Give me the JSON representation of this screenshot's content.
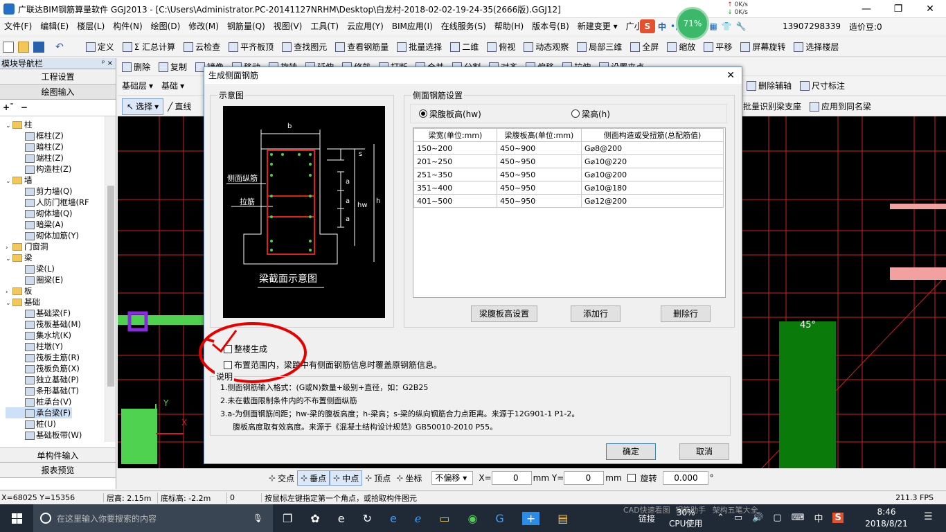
{
  "window": {
    "title": "广联达BIM钢筋算量软件 GGJ2013 - [C:\\Users\\Administrator.PC-20141127NRHM\\Desktop\\白龙村-2018-02-02-19-24-35(2666版).GGJ12]",
    "minimize": "—",
    "restore": "❐",
    "close": "✕"
  },
  "network": {
    "percent": "71%",
    "speed_up": "0K/s",
    "speed_down": "0K/s"
  },
  "menu": [
    "文件(F)",
    "编辑(E)",
    "楼层(L)",
    "构件(N)",
    "绘图(D)",
    "修改(M)",
    "钢筋量(Q)",
    "视图(V)",
    "工具(T)",
    "云应用(Y)",
    "BIM应用(I)",
    "在线服务(S)",
    "帮助(H)",
    "版本号(B)",
    "新建变更 ▾",
    "广小二"
  ],
  "menu_right": {
    "phone": "13907298339",
    "price_beans": "造价豆:0"
  },
  "ime": {
    "lang": "中",
    "punct": "•,"
  },
  "toolbar1": [
    "定义",
    "Σ 汇总计算",
    "云检查",
    "平齐板顶",
    "查找图元",
    "查看钢筋量",
    "批量选择",
    "二维",
    "俯视",
    "动态观察",
    "局部三维",
    "全屏",
    "缩放",
    "平移",
    "屏幕旋转",
    "选择楼层"
  ],
  "toolbar2": [
    "删除",
    "复制",
    "镜像",
    "移动",
    "旋转",
    "延伸",
    "修剪",
    "打断",
    "合并",
    "分割",
    "对齐",
    "偏移",
    "拉伸",
    "设置夹点"
  ],
  "toolbar3": {
    "floor": "基础层",
    "category": "基础",
    "right_items": [
      "删除辅轴",
      "尺寸标注"
    ]
  },
  "toolbar4": {
    "select": "选择",
    "line": "直线",
    "right_items": [
      "批量识别梁支座",
      "应用到同名梁"
    ]
  },
  "left_panel": {
    "title": "模块导航栏",
    "pin": "ᵖ ×",
    "btn_project": "工程设置",
    "btn_draw": "绘图输入",
    "btn_single": "单构件输入",
    "btn_report": "报表预览",
    "tree": [
      {
        "label": "柱",
        "level": 0,
        "folder": true,
        "exp": "⌄"
      },
      {
        "label": "框柱(Z)",
        "level": 1
      },
      {
        "label": "暗柱(Z)",
        "level": 1
      },
      {
        "label": "端柱(Z)",
        "level": 1
      },
      {
        "label": "构造柱(Z)",
        "level": 1
      },
      {
        "label": "墙",
        "level": 0,
        "folder": true,
        "exp": "⌄"
      },
      {
        "label": "剪力墙(Q)",
        "level": 1
      },
      {
        "label": "人防门框墙(RF",
        "level": 1
      },
      {
        "label": "砌体墙(Q)",
        "level": 1
      },
      {
        "label": "暗梁(A)",
        "level": 1
      },
      {
        "label": "砌体加筋(Y)",
        "level": 1
      },
      {
        "label": "门窗洞",
        "level": 0,
        "folder": true,
        "exp": "›"
      },
      {
        "label": "梁",
        "level": 0,
        "folder": true,
        "exp": "⌄"
      },
      {
        "label": "梁(L)",
        "level": 1
      },
      {
        "label": "圈梁(E)",
        "level": 1
      },
      {
        "label": "板",
        "level": 0,
        "folder": true,
        "exp": "›"
      },
      {
        "label": "基础",
        "level": 0,
        "folder": true,
        "exp": "⌄"
      },
      {
        "label": "基础梁(F)",
        "level": 1
      },
      {
        "label": "筏板基础(M)",
        "level": 1
      },
      {
        "label": "集水坑(K)",
        "level": 1
      },
      {
        "label": "柱墩(Y)",
        "level": 1
      },
      {
        "label": "筏板主筋(R)",
        "level": 1
      },
      {
        "label": "筏板负筋(X)",
        "level": 1
      },
      {
        "label": "独立基础(P)",
        "level": 1
      },
      {
        "label": "条形基础(T)",
        "level": 1
      },
      {
        "label": "桩承台(V)",
        "level": 1
      },
      {
        "label": "承台梁(F)",
        "level": 1,
        "selected": true
      },
      {
        "label": "桩(U)",
        "level": 1
      },
      {
        "label": "基础板带(W)",
        "level": 1
      }
    ]
  },
  "dialog": {
    "title": "生成侧面钢筋",
    "close": "✕",
    "diagram_group": "示意图",
    "diagram": {
      "b": "b",
      "s": "s",
      "a1": "a",
      "a2": "a",
      "a3": "a",
      "hw": "hw",
      "h": "h",
      "side_bar": "侧面纵筋",
      "tie": "拉筋",
      "caption": "梁截面示意图"
    },
    "settings_group": "侧面钢筋设置",
    "radio_hw": "梁腹板高(hw)",
    "radio_h": "梁高(h)",
    "table": {
      "headers": [
        "梁宽(单位:mm)",
        "梁腹板高(单位:mm)",
        "侧面构造或受扭筋(总配筋值)"
      ],
      "rows": [
        [
          "150~200",
          "450~900",
          "G⌀8@200"
        ],
        [
          "201~250",
          "450~950",
          "G⌀10@220"
        ],
        [
          "251~350",
          "450~950",
          "G⌀10@200"
        ],
        [
          "351~400",
          "450~950",
          "G⌀10@180"
        ],
        [
          "401~500",
          "450~950",
          "G⌀12@200"
        ]
      ]
    },
    "btn_hw_setting": "梁腹板高设置",
    "btn_add_row": "添加行",
    "btn_delete_row": "删除行",
    "chk_whole_building": "整楼生成",
    "chk_overwrite": "布置范围内，梁跨中有侧面钢筋信息时覆盖原钢筋信息。",
    "notes_title": "说明",
    "notes": [
      "1.侧面钢筋输入格式：(G或N)数量+级别+直径，如：G2B25",
      "2.未在截面限制条件内的不布置侧面纵筋",
      "3.a-为侧面钢筋间距；hw-梁的腹板高度；h-梁高；s-梁的纵向钢筋合力点距离。来源于12G901-1 P1-2。",
      "腹板高度取有效高度。来源于《混凝土结构设计规范》GB50010-2010 P55。"
    ],
    "btn_ok": "确定",
    "btn_cancel": "取消"
  },
  "canvas": {
    "angle_label": "45°",
    "axis_x": "X",
    "axis_y": "Y"
  },
  "snap_bar": {
    "items": [
      "交点",
      "垂点",
      "中点",
      "顶点",
      "坐标"
    ],
    "offset_mode": "不偏移",
    "x_label": "X=",
    "x_value": "0",
    "y_label": "mm Y=",
    "y_value": "0",
    "mm": "mm",
    "rotate_label": "旋转",
    "rotate_value": "0.000",
    "deg": "°"
  },
  "status": {
    "coords": "X=68025 Y=15356",
    "floor_height": "层高: 2.15m",
    "base_height": "底标高: -2.2m",
    "count": "0",
    "hint": "按鼠标左键指定第一个角点，或拾取构件图元",
    "fps": "211.3 FPS"
  },
  "taskbar": {
    "search_placeholder": "在这里输入你要搜索的内容",
    "cpu_percent": "30%",
    "cpu_label": "CPU使用",
    "link": "链接",
    "bg_texts": [
      "CAD快速看图",
      "钢筋助手",
      "架构五笔大全"
    ],
    "lang": "中",
    "time": "8:46",
    "date": "2018/8/21"
  }
}
